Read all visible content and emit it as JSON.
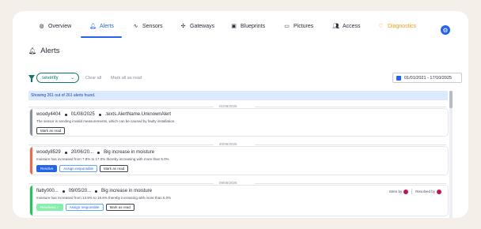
{
  "nav": {
    "tabs": [
      {
        "label": "Overview",
        "icon": "globe-icon"
      },
      {
        "label": "Alerts",
        "icon": "bell-icon"
      },
      {
        "label": "Sensors",
        "icon": "pulse-icon"
      },
      {
        "label": "Gateways",
        "icon": "gateway-icon"
      },
      {
        "label": "Blueprints",
        "icon": "blueprint-icon"
      },
      {
        "label": "Pictures",
        "icon": "picture-icon"
      },
      {
        "label": "Access",
        "icon": "users-icon"
      },
      {
        "label": "Diagnostics",
        "icon": "heart-icon"
      }
    ],
    "active_tab": "Alerts",
    "settings_icon": "gear-icon"
  },
  "page": {
    "title": "Alerts",
    "title_icon": "bell-icon"
  },
  "filters": {
    "severity_value": "severity",
    "clear_all": "Clear all",
    "mark_all_read": "Mark all as read",
    "date_range": "01/01/2021 - 17/10/2025"
  },
  "list": {
    "summary": "Showing 261 out of 261 alerts found.",
    "groups": [
      {
        "date": "01/08/2025",
        "alert": {
          "title_device": "woody4404",
          "title_date": "01/08/2025",
          "title_name": ".texts.AlertName.UnknownAlert",
          "description": "The sensor is sending invalid measurements, which can be caused by faulty installation.",
          "buttons": [
            "Mark as read"
          ],
          "color": "#8a8f9c"
        }
      },
      {
        "date": "20/06/2025",
        "alert": {
          "title_device": "woody8529",
          "title_date": "20/06/20...",
          "title_name": "Big increase in moisture",
          "description": "moisture has increased from 7.8% to 17.0% thereby increasing with more than 5.0%",
          "buttons": [
            "Resolve",
            "Assign responsible",
            "Mark as read"
          ],
          "color": "#ef6b47"
        }
      },
      {
        "date": "09/05/2025",
        "alert": {
          "title_device": "flatty000...",
          "title_date": "09/05/20...",
          "title_name": "Big increase in moisture",
          "description": "moisture has increased from 13.9% to 19.6% thereby increasing with more than 5.0%",
          "buttons": [
            "Resolved ✓",
            "Assign responsible",
            "Mark as read"
          ],
          "seen_by": "Seen by",
          "resolved_by": "Resolved by",
          "color": "#22c55e"
        }
      }
    ]
  },
  "colors": {
    "accent": "#2563eb",
    "diagnostics": "#f59e0b",
    "teal": "#0f766e"
  }
}
